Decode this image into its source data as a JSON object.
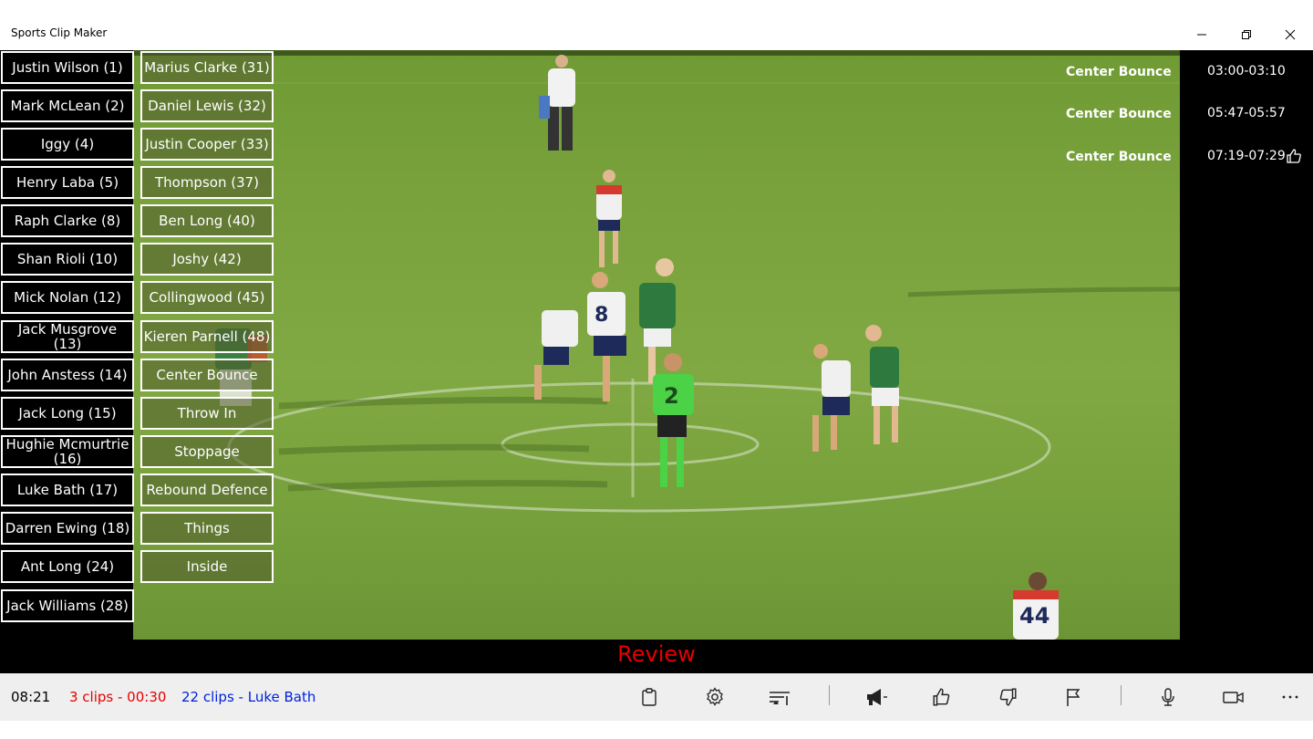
{
  "window": {
    "title": "Sports Clip Maker"
  },
  "players": [
    "Justin Wilson (1)",
    "Mark McLean (2)",
    "Iggy (4)",
    "Henry Laba (5)",
    "Raph Clarke (8)",
    "Shan Rioli (10)",
    "Mick Nolan (12)",
    "Jack Musgrove (13)",
    "John Anstess (14)",
    "Jack Long (15)",
    "Hughie Mcmurtrie (16)",
    "Luke Bath (17)",
    "Darren Ewing (18)",
    "Ant Long (24)",
    "Jack Williams (28)"
  ],
  "tags": [
    "Marius Clarke (31)",
    "Daniel Lewis (32)",
    "Justin Cooper (33)",
    "Thompson (37)",
    "Ben Long (40)",
    "Joshy (42)",
    "Collingwood (45)",
    "Kieren Parnell (48)",
    "Center Bounce",
    "Throw In",
    "Stoppage",
    "Rebound Defence",
    "Things",
    "Inside"
  ],
  "clips": [
    {
      "label": "Center Bounce",
      "time": "03:00-03:10"
    },
    {
      "label": "Center Bounce",
      "time": "05:47-05:57"
    },
    {
      "label": "Center Bounce",
      "time": "07:19-07:29"
    }
  ],
  "review_label": "Review",
  "status": {
    "time": "08:21",
    "selection": "3 clips - 00:30",
    "total": "22 clips - Luke Bath"
  },
  "colors": {
    "review": "#e50000",
    "selection": "#e60000",
    "total": "#0022dd",
    "field": "#7ba23e"
  },
  "toolbar_icons": [
    "clipboard-icon",
    "gear-icon",
    "filter-sort-icon",
    "megaphone-icon",
    "thumbs-up-icon",
    "thumbs-down-icon",
    "flag-icon",
    "microphone-icon",
    "video-camera-icon",
    "more-icon"
  ]
}
